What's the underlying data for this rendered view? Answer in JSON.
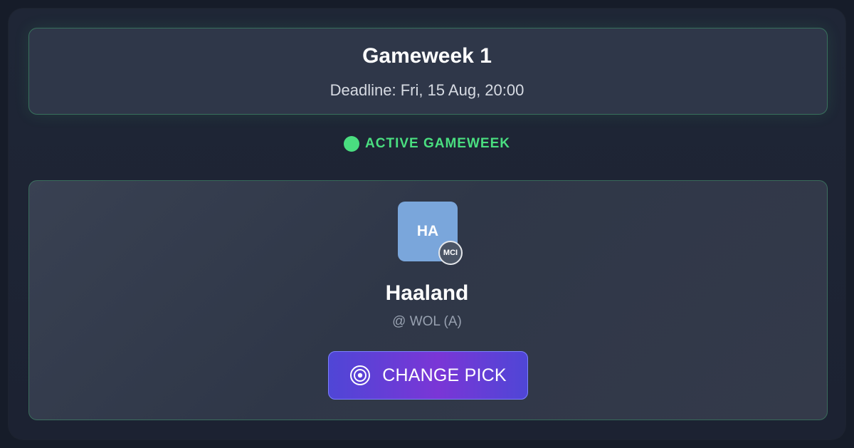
{
  "gameweek": {
    "title": "Gameweek 1",
    "deadline": "Deadline: Fri, 15 Aug, 20:00"
  },
  "status": {
    "label": "ACTIVE GAMEWEEK",
    "color": "#4ade80"
  },
  "pick": {
    "initials": "HA",
    "team_badge": "MCI",
    "player_name": "Haaland",
    "fixture": "@ WOL (A)",
    "avatar_color": "#7aa6db"
  },
  "actions": {
    "change_pick_label": "CHANGE PICK",
    "change_pick_icon": "target-icon"
  }
}
